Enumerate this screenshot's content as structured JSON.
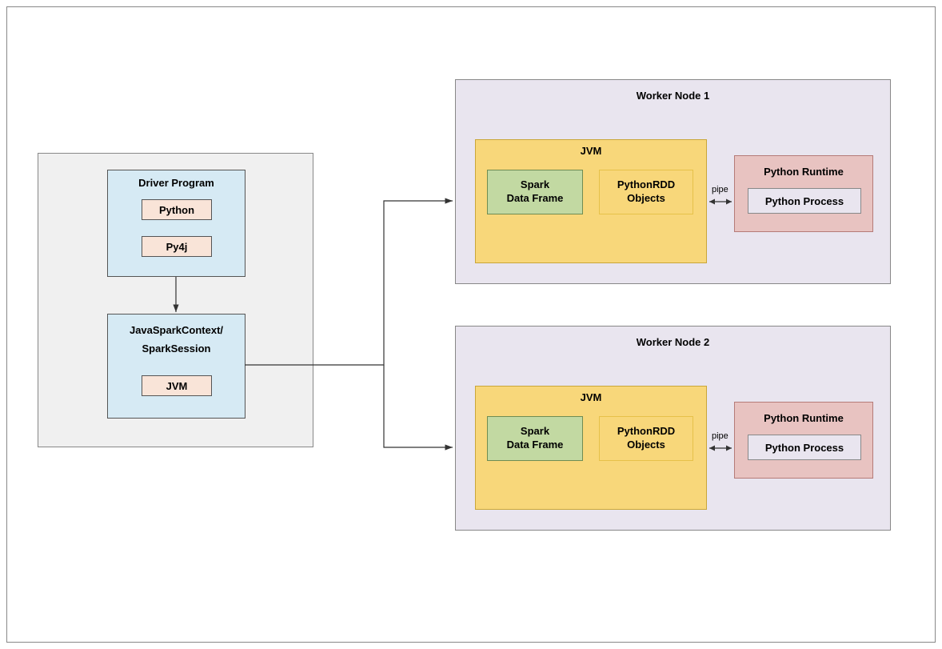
{
  "driver": {
    "program_title": "Driver Program",
    "python_label": "Python",
    "py4j_label": "Py4j",
    "context_title_line1": "JavaSparkContext/",
    "context_title_line2": "SparkSession",
    "jvm_label": "JVM"
  },
  "worker1": {
    "title": "Worker Node 1",
    "jvm_title": "JVM",
    "spark_df": "Spark Data Frame",
    "python_rdd": "PythonRDD Objects",
    "runtime_title": "Python Runtime",
    "process_label": "Python Process",
    "pipe_label": "pipe"
  },
  "worker2": {
    "title": "Worker Node 2",
    "jvm_title": "JVM",
    "spark_df": "Spark Data Frame",
    "python_rdd": "PythonRDD Objects",
    "runtime_title": "Python Runtime",
    "process_label": "Python Process",
    "pipe_label": "pipe"
  }
}
